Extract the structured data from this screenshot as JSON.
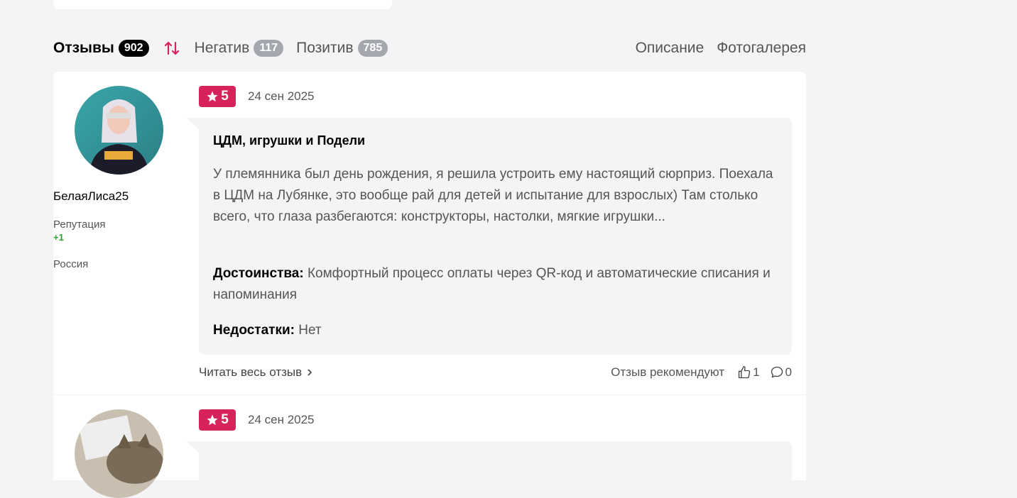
{
  "tabs": {
    "reviews": {
      "label": "Отзывы",
      "count": "902"
    },
    "negative": {
      "label": "Негатив",
      "count": "117"
    },
    "positive": {
      "label": "Позитив",
      "count": "785"
    },
    "description": "Описание",
    "gallery": "Фотогалерея"
  },
  "colors": {
    "accent": "#d6245b",
    "reputation": "#2ea52e",
    "count_badge": "#a5a7ae"
  },
  "reviews": [
    {
      "author": "БелаяЛиса25",
      "reputation_label": "Репутация",
      "reputation_value": "+1",
      "country": "Россия",
      "rating": "5",
      "date": "24 сен 2025",
      "title": "ЦДМ, игрушки и Подели",
      "text": "У племянника был день рождения, я решила устроить ему настоящий сюрприз. Поехала в ЦДМ на Лубянке, это вообще рай для детей и испытание для взрослых) Там столько всего, что глаза разбегаются: конструкторы, настолки, мягкие игрушки...",
      "pros_label": "Достоинства:",
      "pros": "Комфортный процесс оплаты через QR-код и автоматические списания и напоминания",
      "cons_label": "Недостатки:",
      "cons": "Нет",
      "read_more": "Читать весь отзыв",
      "recommend_label": "Отзыв рекомендуют",
      "likes": "1",
      "comments": "0"
    },
    {
      "rating": "5",
      "date": "24 сен 2025"
    }
  ]
}
